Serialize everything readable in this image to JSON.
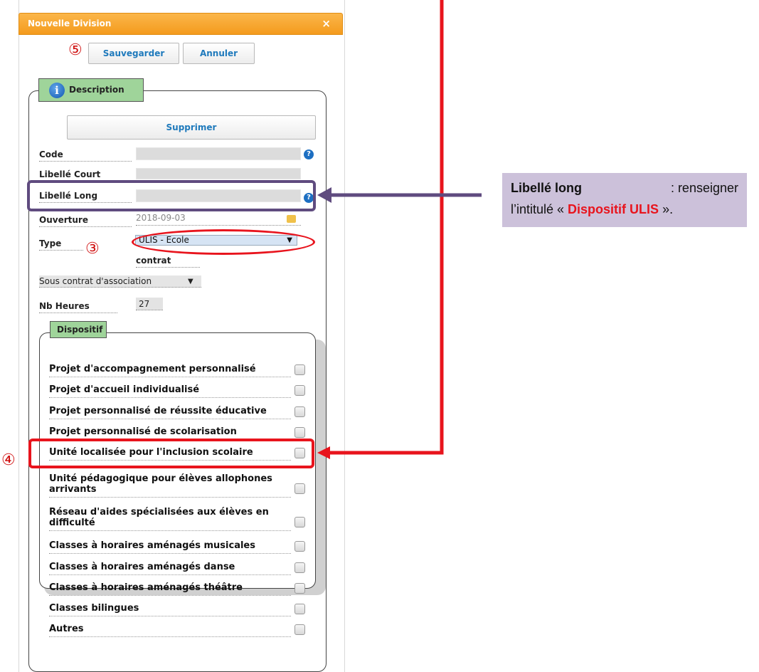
{
  "dialog": {
    "title": "Nouvelle Division",
    "close_glyph": "×",
    "save_label": "Sauvegarder",
    "cancel_label": "Annuler",
    "description_legend": "Description",
    "info_glyph": "i",
    "delete_label": "Supprimer",
    "help_glyph": "?"
  },
  "fields": {
    "code_label": "Code",
    "libelle_court_label": "Libellé Court",
    "libelle_long_label": "Libellé Long",
    "ouverture_label": "Ouverture",
    "ouverture_value": "2018-09-03",
    "type_label": "Type",
    "type_value": "ULIS - Ecole",
    "contrat_label": "contrat",
    "contrat_value": "Sous contrat d'association",
    "nb_heures_label": "Nb Heures",
    "nb_heures_value": "27"
  },
  "dispositif": {
    "legend": "Dispositif",
    "items": [
      {
        "label": "Projet d'accompagnement personnalisé"
      },
      {
        "label": "Projet d'accueil individualisé"
      },
      {
        "label": "Projet personnalisé de réussite éducative"
      },
      {
        "label": "Projet personnalisé de scolarisation"
      },
      {
        "label": "Unité localisée pour l'inclusion scolaire"
      },
      {
        "label": "Unité pédagogique pour élèves allophones arrivants"
      },
      {
        "label": "Réseau d'aides spécialisées aux élèves en difficulté"
      },
      {
        "label": "Classes à horaires aménagés musicales"
      },
      {
        "label": "Classes à horaires aménagés danse"
      },
      {
        "label": "Classes à horaires aménagés théâtre"
      },
      {
        "label": "Classes bilingues"
      },
      {
        "label": "Autres"
      }
    ]
  },
  "annotations": {
    "step3": "③",
    "step4": "④",
    "step5": "⑤",
    "callout_bold": "Libellé long",
    "callout_text1": " : renseigner",
    "callout_text2": "l’intitulé « ",
    "callout_highlight": "Dispositif ULIS",
    "callout_text3": " ».",
    "callout_bg": "#ccc1da",
    "highlight_color": "#e8141d",
    "frame_color": "#5f4b7f"
  }
}
